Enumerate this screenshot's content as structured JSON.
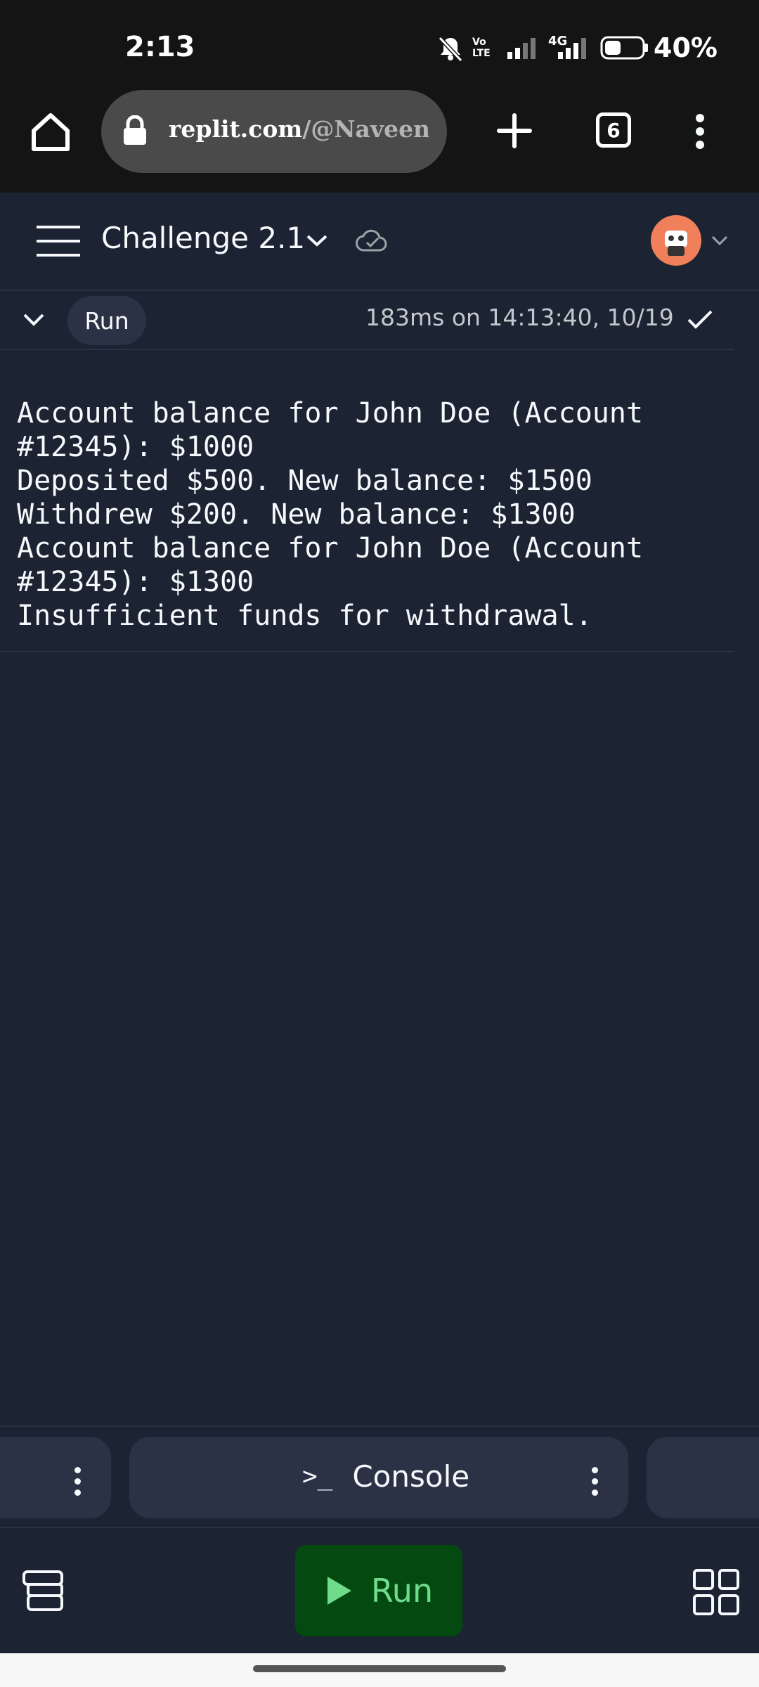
{
  "status_bar": {
    "time": "2:13",
    "network_label": "4G",
    "battery": "40%"
  },
  "browser": {
    "url_host": "replit.com",
    "url_path": "/@NaveenA",
    "tab_count": "6"
  },
  "ide": {
    "repl_title": "Challenge 2.1",
    "run_label": "Run",
    "run_meta": "183ms on 14:13:40, 10/19",
    "console_output": [
      "Account balance for John Doe (Account",
      "#12345): $1000",
      "Deposited $500. New balance: $1500",
      "Withdrew $200. New balance: $1300",
      "Account balance for John Doe (Account",
      "#12345): $1300",
      "Insufficient funds for withdrawal."
    ],
    "console_tab_label": "Console",
    "console_prompt_glyph": ">_",
    "run_button_label": "Run"
  },
  "colors": {
    "background": "#1c2333",
    "panel": "#2b3245",
    "run_button_bg": "#044a10",
    "run_button_fg": "#6fdc8c",
    "avatar": "#f0805a"
  },
  "icons": {
    "home": "home-icon",
    "lock": "lock-icon",
    "new_tab": "plus-icon",
    "tabs": "tab-count-icon",
    "menu": "kebab-menu-icon",
    "hamburger": "hamburger-icon",
    "chevron": "chevron-down-icon",
    "cloud": "cloud-check-icon",
    "check": "checkmark-icon",
    "play": "play-icon",
    "layers": "layers-icon",
    "grid": "grid-icon"
  }
}
